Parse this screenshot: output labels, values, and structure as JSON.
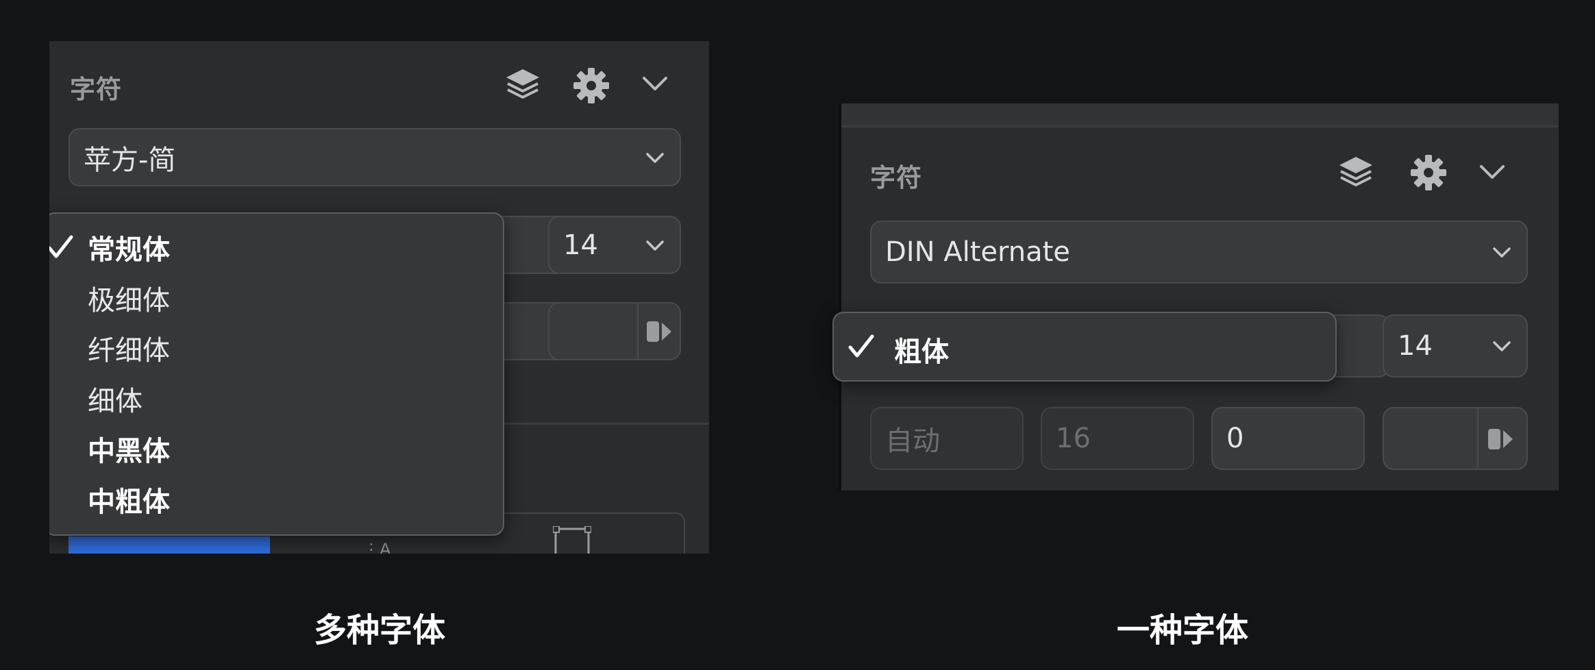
{
  "left": {
    "section_title": "字符",
    "font_family": "苹方-简",
    "font_size": "14",
    "style_menu": {
      "selected": "常规体",
      "items": [
        {
          "label": "常规体",
          "bold": true,
          "checked": true
        },
        {
          "label": "极细体",
          "bold": false,
          "checked": false
        },
        {
          "label": "纤细体",
          "bold": false,
          "checked": false
        },
        {
          "label": "细体",
          "bold": false,
          "checked": false
        },
        {
          "label": "中黑体",
          "bold": true,
          "checked": false
        },
        {
          "label": "中粗体",
          "bold": true,
          "checked": false
        }
      ]
    },
    "caption": "多种字体"
  },
  "right": {
    "section_title": "字符",
    "font_family": "DIN Alternate",
    "font_size": "14",
    "style_menu": {
      "items": [
        {
          "label": "粗体",
          "bold": true,
          "checked": true
        }
      ]
    },
    "spacing_fields": {
      "char_spacing": "自动",
      "line_height": "16",
      "paragraph": "0"
    },
    "caption": "一种字体"
  },
  "icons": {
    "layers": "layers-icon",
    "gear": "gear-icon",
    "chevron": "chevron-down-icon",
    "check": "checkmark-icon",
    "color_picker": "color-dropper-icon"
  },
  "colors": {
    "background": "#131416",
    "panel": "#2b2c2f",
    "accent": "#2f6bd9"
  }
}
